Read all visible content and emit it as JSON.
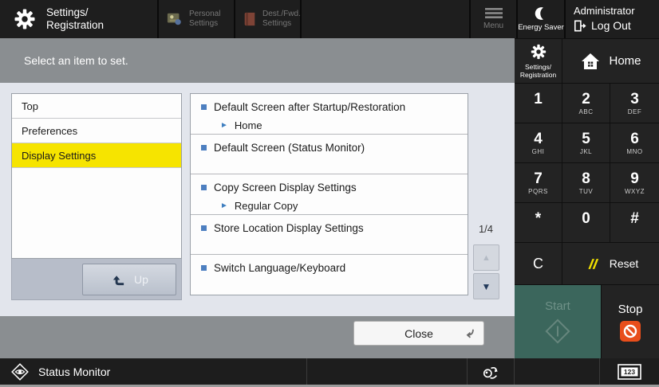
{
  "colors": {
    "accent_yellow": "#f6e400",
    "start_teal": "#3b665c",
    "stop_orange": "#e84e1b",
    "reset_yellow": "#f0e000",
    "bullet_blue": "#4d7fc0",
    "bar_gray": "#8a8e91",
    "dark_bg": "#1e1e1e"
  },
  "header": {
    "title_line1": "Settings/",
    "title_line2": "Registration",
    "tabs": [
      {
        "line1": "Personal",
        "line2": "Settings"
      },
      {
        "line1": "Dest./Fwd.",
        "line2": "Settings"
      }
    ],
    "menu_label": "Menu",
    "energy_saver_label": "Energy Saver",
    "user_name": "Administrator",
    "logout_label": "Log Out"
  },
  "message_bar": {
    "text": "Select an item to set."
  },
  "nav_panel": {
    "items": [
      {
        "label": "Top",
        "selected": false
      },
      {
        "label": "Preferences",
        "selected": false
      },
      {
        "label": "Display Settings",
        "selected": true
      }
    ],
    "up_label": "Up"
  },
  "settings_panel": {
    "items": [
      {
        "label": "Default Screen after Startup/Restoration",
        "value": "Home"
      },
      {
        "label": "Default Screen (Status Monitor)",
        "value": ""
      },
      {
        "label": "Copy Screen Display Settings",
        "value": "Regular Copy"
      },
      {
        "label": "Store Location Display Settings",
        "value": ""
      },
      {
        "label": "Switch Language/Keyboard",
        "value": ""
      }
    ],
    "page_indicator": "1/4"
  },
  "close_button": {
    "label": "Close"
  },
  "sidebar": {
    "settings_reg_line1": "Settings/",
    "settings_reg_line2": "Registration",
    "home_label": "Home",
    "keys": [
      {
        "digit": "1",
        "letters": ""
      },
      {
        "digit": "2",
        "letters": "ABC"
      },
      {
        "digit": "3",
        "letters": "DEF"
      },
      {
        "digit": "4",
        "letters": "GHI"
      },
      {
        "digit": "5",
        "letters": "JKL"
      },
      {
        "digit": "6",
        "letters": "MNO"
      },
      {
        "digit": "7",
        "letters": "PQRS"
      },
      {
        "digit": "8",
        "letters": "TUV"
      },
      {
        "digit": "9",
        "letters": "WXYZ"
      },
      {
        "digit": "*",
        "letters": ""
      },
      {
        "digit": "0",
        "letters": ""
      },
      {
        "digit": "#",
        "letters": ""
      }
    ],
    "clear_label": "C",
    "reset_label": "Reset",
    "start_label": "Start",
    "stop_label": "Stop"
  },
  "footer": {
    "status_monitor_label": "Status Monitor",
    "counter_label": "123"
  }
}
